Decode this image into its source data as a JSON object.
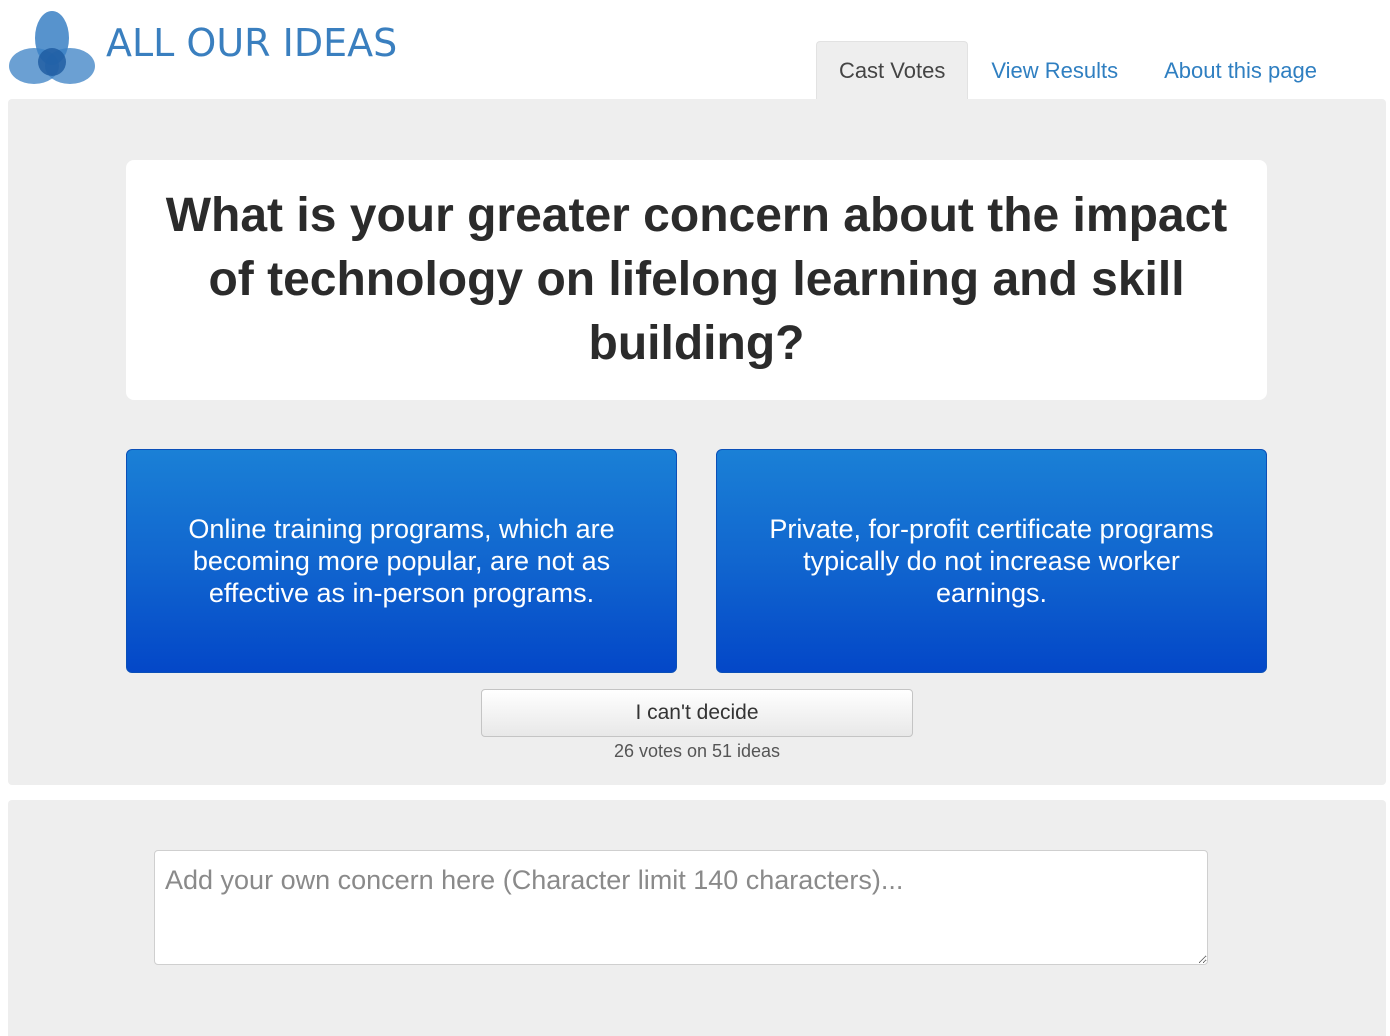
{
  "brand": {
    "name": "ALL OUR IDEAS",
    "logo_icon": "triple-petal-logo-icon",
    "color": "#3a7fbf"
  },
  "nav": {
    "tabs": [
      {
        "label": "Cast Votes",
        "active": true
      },
      {
        "label": "View Results",
        "active": false
      },
      {
        "label": "About this page",
        "active": false
      }
    ]
  },
  "question": {
    "text": "What is your greater concern about the impact of technology on lifelong learning and skill building?"
  },
  "choices": {
    "left": "Online training programs, which are becoming more popular, are not as effective as in-person programs.",
    "right": "Private, for-profit certificate programs typically do not increase worker earnings."
  },
  "actions": {
    "cant_decide": "I can't decide",
    "vote_summary": "26 votes on 51 ideas"
  },
  "add_idea": {
    "placeholder": "Add your own concern here (Character limit 140 characters)...",
    "value": ""
  },
  "colors": {
    "choice_top": "#1a80d6",
    "choice_bottom": "#0347c8",
    "link": "#2f7fc1",
    "panel_bg": "#eeeeee"
  }
}
